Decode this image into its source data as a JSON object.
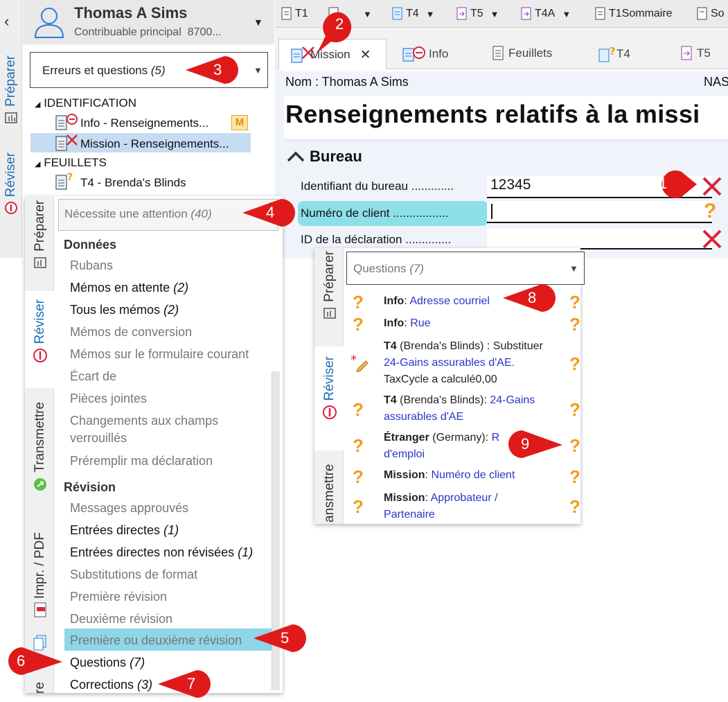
{
  "taxpayer": {
    "name": "Thomas A Sims",
    "role": "Contribuable principal",
    "sin_partial": "8700..."
  },
  "left_tabs": {
    "prepare": "Préparer",
    "review": "Réviser"
  },
  "filter": {
    "label": "Erreurs et questions",
    "count": "(5)"
  },
  "tree": {
    "group1": "IDENTIFICATION",
    "item1": "Info - Renseignements...",
    "item1_badge": "M",
    "item2": "Mission - Renseignements...",
    "group2": "FEUILLETS",
    "item3": "T4 - Brenda's Blinds"
  },
  "form_tabs": [
    "T1",
    "T4",
    "T5",
    "T4A",
    "T1Sommaire",
    "So"
  ],
  "sub_tabs": {
    "mission": "Mission",
    "info": "Info",
    "feuillets": "Feuillets",
    "t4": "T4",
    "t5": "T5"
  },
  "form": {
    "name_label": "Nom : Thomas A Sims",
    "nas_label": "NAS",
    "heading": "Renseignements relatifs à la missi",
    "section": "Bureau",
    "field1_label": "Identifiant du bureau .............",
    "field1_value": "12345",
    "field2_label": "Numéro de client .................",
    "field3_label": "ID de la déclaration ..............",
    "highlight_color": "#8ee0e8",
    "error_color": "#d7263d",
    "question_color": "#f39a1b"
  },
  "popup1": {
    "tabs": {
      "prepare": "Préparer",
      "review": "Réviser",
      "transmit": "Transmettre",
      "print": "Impr. / PDF",
      "other": "re"
    },
    "dropdown_label": "Nécessite une attention",
    "dropdown_count": "(40)",
    "section_data": "Données",
    "items_data": [
      {
        "label": "Rubans",
        "count": ""
      },
      {
        "label": "Mémos en attente",
        "count": "(2)"
      },
      {
        "label": "Tous les mémos",
        "count": "(2)"
      },
      {
        "label": "Mémos de conversion",
        "count": ""
      },
      {
        "label": "Mémos sur le formulaire courant",
        "count": ""
      },
      {
        "label": "Écart de",
        "count": ""
      },
      {
        "label": "Pièces jointes",
        "count": ""
      },
      {
        "label": "Changements aux champs",
        "count": ""
      },
      {
        "label": "verrouillés",
        "count": ""
      },
      {
        "label": "Préremplir ma déclaration",
        "count": ""
      }
    ],
    "section_review": "Révision",
    "items_review": [
      {
        "label": "Messages approuvés",
        "count": ""
      },
      {
        "label": "Entrées directes",
        "count": "(1)"
      },
      {
        "label": "Entrées directes non révisées",
        "count": "(1)"
      },
      {
        "label": "Substitutions de format",
        "count": ""
      },
      {
        "label": "Première révision",
        "count": ""
      },
      {
        "label": "Deuxième révision",
        "count": ""
      },
      {
        "label": "Première ou deuxième révision",
        "count": ""
      },
      {
        "label": "Questions",
        "count": "(7)"
      },
      {
        "label": "Corrections",
        "count": "(3)"
      }
    ]
  },
  "popup2": {
    "tabs": {
      "prepare": "Préparer",
      "review": "Réviser",
      "transmit": "ansmettre"
    },
    "dropdown_label": "Questions",
    "dropdown_count": "(7)",
    "q1": {
      "form": "Info",
      "link": "Adresse courriel"
    },
    "q2": {
      "form": "Info",
      "link": "Rue"
    },
    "q3": {
      "form": "T4",
      "detail": " (Brenda's Blinds) : Substituer",
      "link": "24-Gains assurables d'AE.",
      "note": "TaxCycle a calculé0,00"
    },
    "q4": {
      "form": "T4",
      "detail": " (Brenda's Blinds): ",
      "link": "24-Gains assurables d'AE"
    },
    "q5": {
      "form": "Étranger",
      "detail": " (Germany): ",
      "link": "R",
      "link2": "d'emploi"
    },
    "q6": {
      "form": "Mission",
      "link": "Numéro de client"
    },
    "q7": {
      "form": "Mission",
      "link": "Approbateur /",
      "link2": "Partenaire"
    }
  },
  "callouts": [
    "1",
    "2",
    "3",
    "4",
    "5",
    "6",
    "7",
    "8",
    "9"
  ]
}
